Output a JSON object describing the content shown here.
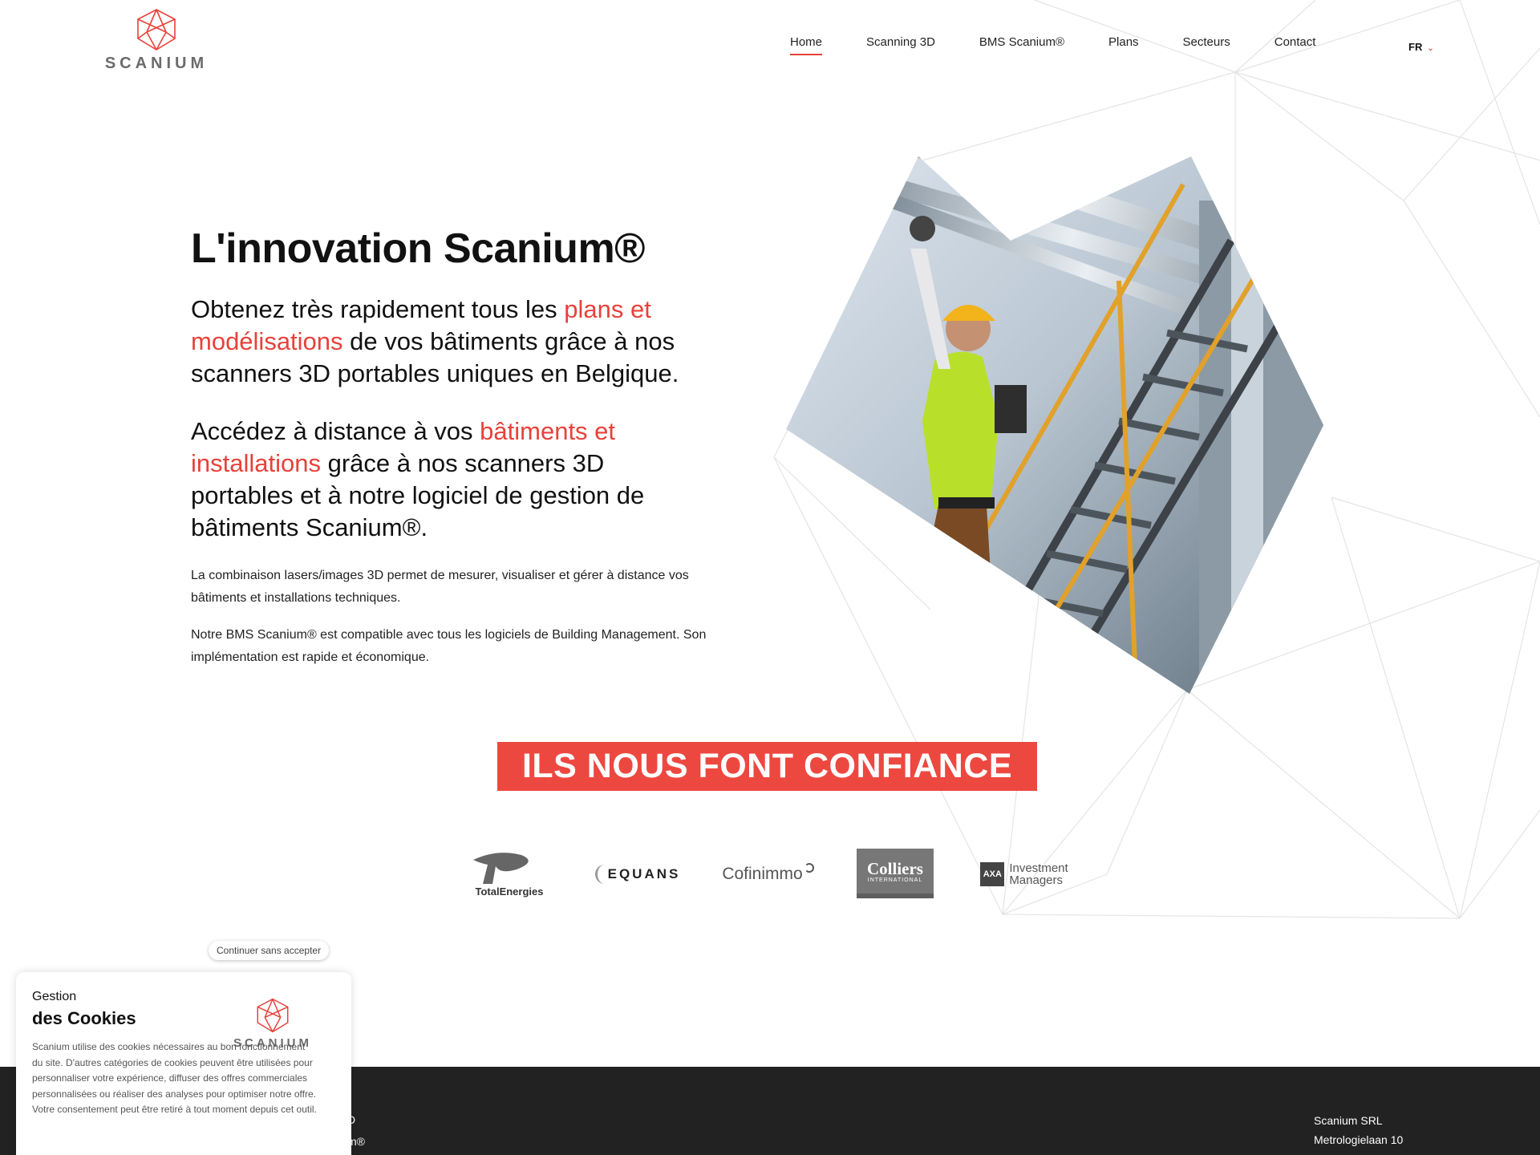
{
  "brand": {
    "name": "SCANIUM",
    "accent": "#e8413a",
    "text": "#111111",
    "footer_bg": "#222222"
  },
  "nav": {
    "items": [
      {
        "label": "Home",
        "active": true
      },
      {
        "label": "Scanning 3D",
        "active": false
      },
      {
        "label": "BMS Scanium®",
        "active": false
      },
      {
        "label": "Plans",
        "active": false
      },
      {
        "label": "Secteurs",
        "active": false
      },
      {
        "label": "Contact",
        "active": false
      }
    ],
    "lang": "FR"
  },
  "hero": {
    "title": "L'innovation Scanium®",
    "lead1": {
      "pre": "Obtenez très rapidement tous les ",
      "highlight": "plans et modélisations",
      "post": " de vos bâtiments grâce à nos scanners 3D portables uniques en Belgique."
    },
    "lead2": {
      "pre": "Accédez à distance à vos ",
      "highlight": "bâtiments et installations",
      "post": " grâce à nos scanners 3D portables et à notre logiciel de gestion de bâtiments Scanium®."
    },
    "p1": "La combinaison lasers/images 3D permet de mesurer, visualiser et gérer à distance vos bâtiments et installations techniques.",
    "p2": "Notre BMS Scanium® est compatible avec tous les logiciels de Building Management. Son implémentation est rapide et économique."
  },
  "trust": {
    "title": "ILS NOUS FONT CONFIANCE"
  },
  "partners": {
    "total": "TotalEnergies",
    "equans": "EQUANS",
    "cofinimmo": "Cofinimmo",
    "colliers": "Colliers",
    "colliers_sub": "INTERNATIONAL",
    "axa_box": "AXA",
    "axa_line1": "Investment",
    "axa_line2": "Managers"
  },
  "footer": {
    "company": "Scanium SRL",
    "street": "Metrologielaan 10",
    "left_line1": "D",
    "left_line2": "m®"
  },
  "cookies": {
    "continue": "Continuer sans accepter",
    "heading_small": "Gestion",
    "heading_big": "des Cookies",
    "text": "Scanium utilise des cookies nécessaires au bon fonctionnement du site. D'autres catégories de cookies peuvent être utilisées pour personnaliser votre expérience, diffuser des offres commerciales personnalisées ou réaliser des analyses pour optimiser notre offre. Votre consentement peut être retiré à tout moment depuis cet outil.",
    "logo": "SCANIUM"
  }
}
